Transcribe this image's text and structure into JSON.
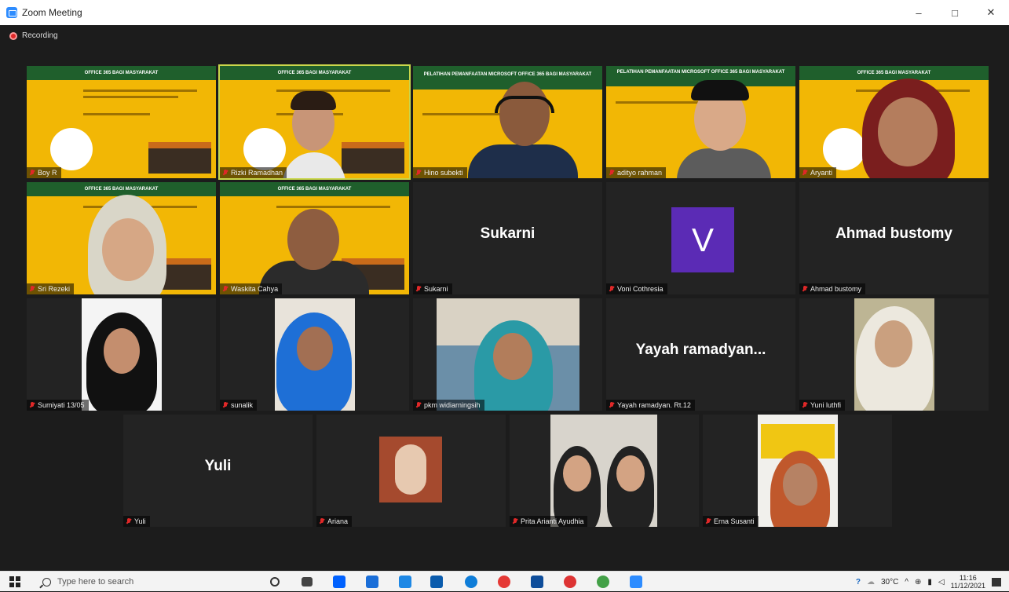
{
  "window": {
    "title": "Zoom Meeting",
    "minimize": "–",
    "maximize": "□",
    "close": "✕"
  },
  "meeting": {
    "recording_label": "Recording"
  },
  "slide": {
    "header": "OFFICE 365 BAGI MASYARAKAT",
    "header_alt": "PELATIHAN PEMANFAATAN MICROSOFT OFFICE 365 BAGI MASYARAKAT"
  },
  "participants": [
    {
      "name": "Boy R"
    },
    {
      "name": "Rizki Ramadhan"
    },
    {
      "name": "Hino subekti"
    },
    {
      "name": "adityo rahman"
    },
    {
      "name": "Aryanti"
    },
    {
      "name": "Sri Rezeki"
    },
    {
      "name": "Waskita Cahya"
    },
    {
      "name": "Sukarni",
      "display": "Sukarni"
    },
    {
      "name": "Voni Cothresia",
      "avatar_letter": "V"
    },
    {
      "name": "Ahmad bustomy",
      "display": "Ahmad bustomy"
    },
    {
      "name": "Sumiyati 13/05"
    },
    {
      "name": "sunalik"
    },
    {
      "name": "pkm widiarningsih"
    },
    {
      "name": "Yayah ramadyan. Rt.12",
      "display": "Yayah ramadyan..."
    },
    {
      "name": "Yuni luthfi"
    },
    {
      "name": "Yuli",
      "display": "Yuli"
    },
    {
      "name": "Ariana"
    },
    {
      "name": "Prita Arianti Ayudhia"
    },
    {
      "name": "Erna Susanti"
    }
  ],
  "taskbar": {
    "search_placeholder": "Type here to search",
    "temperature": "30°C",
    "time": "11:16",
    "date": "11/12/2021"
  }
}
